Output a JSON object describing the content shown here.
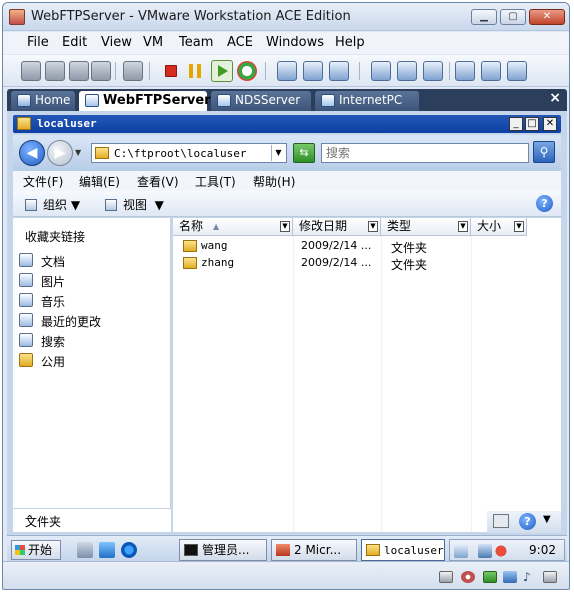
{
  "vm": {
    "title": "WebFTPServer - VMware Workstation ACE Edition",
    "menu": [
      "File",
      "Edit",
      "View",
      "VM",
      "Team",
      "ACE",
      "Windows",
      "Help"
    ],
    "tabs": [
      {
        "label": "Home",
        "active": false
      },
      {
        "label": "WebFTPServer",
        "active": true
      },
      {
        "label": "NDSServer",
        "active": false
      },
      {
        "label": "InternetPC",
        "active": false
      }
    ],
    "tabs_close": "×"
  },
  "explorer": {
    "title": "localuser",
    "address": "C:\\ftproot\\localuser",
    "search_placeholder": "搜索",
    "menu": [
      "文件(F)",
      "编辑(E)",
      "查看(V)",
      "工具(T)",
      "帮助(H)"
    ],
    "commands": {
      "organize": "组织",
      "views": "视图"
    },
    "left_heading": "收藏夹链接",
    "links": [
      {
        "label": "文档",
        "icon": "documents-icon"
      },
      {
        "label": "图片",
        "icon": "pictures-icon"
      },
      {
        "label": "音乐",
        "icon": "music-icon"
      },
      {
        "label": "最近的更改",
        "icon": "recent-changes-icon"
      },
      {
        "label": "搜索",
        "icon": "search-folder-icon"
      },
      {
        "label": "公用",
        "icon": "public-folder-icon"
      }
    ],
    "folders_label": "文件夹",
    "columns": [
      "名称",
      "修改日期",
      "类型",
      "大小"
    ],
    "rows": [
      {
        "name": "wang",
        "date": "2009/2/14 ...",
        "type": "文件夹"
      },
      {
        "name": "zhang",
        "date": "2009/2/14 ...",
        "type": "文件夹"
      }
    ]
  },
  "taskbar": {
    "start": "开始",
    "tasks": [
      {
        "label": "管理员...",
        "active": false
      },
      {
        "label": "2 Micr...",
        "active": false
      },
      {
        "label": "localuser",
        "active": true
      }
    ],
    "clock": "9:02"
  }
}
